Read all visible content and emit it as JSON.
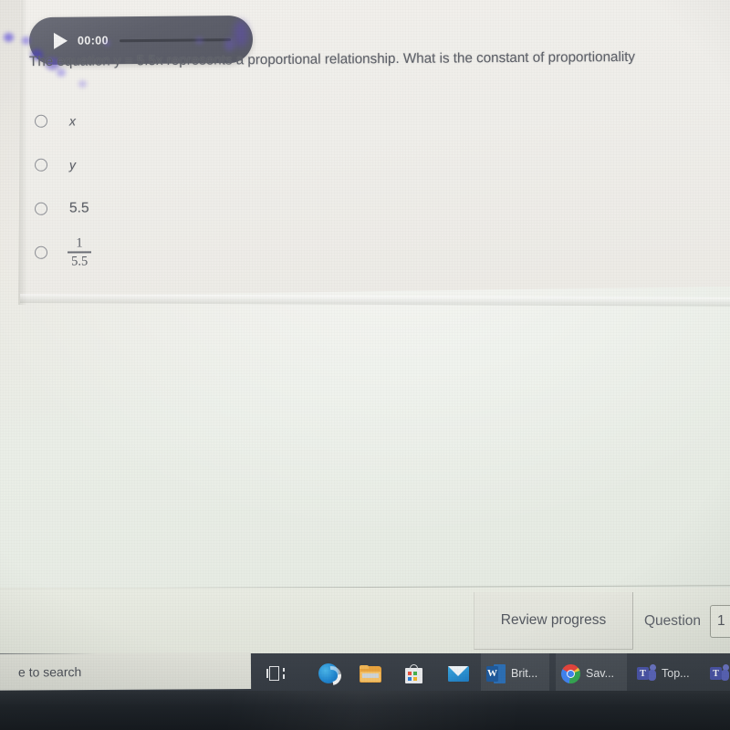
{
  "quiz": {
    "audio_player": {
      "play_icon": "play-icon",
      "time": "00:00"
    },
    "question_text": "The equation y = 5.5x represents a proportional relationship. What is the constant of proportionality",
    "choices": [
      {
        "id": "a",
        "label": "x",
        "style": "italic",
        "selected": false
      },
      {
        "id": "b",
        "label": "y",
        "style": "italic",
        "selected": false
      },
      {
        "id": "c",
        "label": "5.5",
        "style": "number",
        "selected": false
      },
      {
        "id": "d",
        "numerator": "1",
        "denominator": "5.5",
        "style": "fraction",
        "selected": false
      }
    ]
  },
  "toolbar": {
    "review_progress_label": "Review progress",
    "question_label": "Question",
    "question_number": "1"
  },
  "taskbar": {
    "search_placeholder": "e to search",
    "items": [
      {
        "icon": "task-view-icon",
        "label": ""
      },
      {
        "icon": "edge-icon",
        "label": ""
      },
      {
        "icon": "file-explorer-icon",
        "label": ""
      },
      {
        "icon": "microsoft-store-icon",
        "label": ""
      },
      {
        "icon": "mail-icon",
        "label": ""
      },
      {
        "icon": "word-icon",
        "label": "Brit...",
        "letter": "W"
      },
      {
        "icon": "chrome-icon",
        "label": "Sav..."
      },
      {
        "icon": "teams-icon",
        "label": "Top...",
        "letter": "T"
      },
      {
        "icon": "teams-icon",
        "label": "",
        "letter": "T"
      }
    ]
  },
  "colors": {
    "card_background": "#f0efed",
    "page_background": "#e9ece5",
    "audio_player": "#5e606b",
    "text": "#5b5e66",
    "taskbar": "#343a42",
    "accent_underline": "#6fc8e8"
  }
}
